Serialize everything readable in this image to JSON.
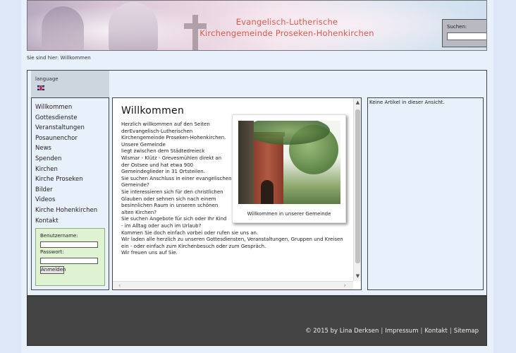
{
  "header": {
    "title_line1": "Evangelisch-Lutherische",
    "title_line2": "Kirchengemeinde Proseken-Hohenkirchen",
    "search_label": "Suchen:",
    "search_value": "",
    "search_button_icon": "search-icon"
  },
  "breadcrumb": "Sie sind hier: Willkommen",
  "sidebar": {
    "language_label": "language",
    "language_flag_icon": "uk-flag-icon",
    "nav": [
      "Willkommen",
      "Gottesdienste",
      "Veranstaltungen",
      "Posaunenchor",
      "News",
      "Spenden",
      "Kirchen",
      "Kirche Proseken",
      "Bilder",
      "Videos",
      "Kirche Hohenkirchen",
      "Kontakt"
    ],
    "login": {
      "username_label": "Benutzername:",
      "password_label": "Passwort:",
      "button_label": "Anmelden"
    }
  },
  "content": {
    "title": "Willkommen",
    "lines": [
      "Herzlich willkommen auf den Seiten",
      "derEvangelisch-Lutherischen",
      "Kirchengemeinde  Proseken-Hohenkirchen.",
      "Unsere Gemeinde",
      "liegt zwischen dem Städtedreieck",
      "Wismar - Klütz - Grevesmühlen direkt an",
      "der Ostsee und hat etwa 900",
      "Gemeindeglieder in 31 Ortsteilen.",
      "Sie suchen Anschluss in einer evangelischen",
      "Gemeinde?",
      "Sie interessieren sich für den christlichen",
      "Glauben oder sehnen sich nach einem",
      "besinnlichen Raum in unseren schönen",
      "alten Kirchen?",
      "Sie suchen Angebote für sich oder Ihr Kind",
      "- im Alltag oder auch im Urlaub?",
      "Kommen Sie doch einfach vorbei oder rufen sie uns an.",
      "Wir laden alle herzlich zu unseren Gottesdiensten, Veranstaltungen, Gruppen und Kreisen",
      "ein - oder einfach zum Kirchenbesuch oder zum Gespräch.",
      "Wir freuen uns auf Sie."
    ],
    "photo_caption": "Willkommen in unserer Gemeinde"
  },
  "rightcol": {
    "text": "Keine Artikel in dieser Ansicht."
  },
  "footer": {
    "copyright": "©  2015  by Lina Derksen",
    "links": [
      "Impressum",
      "Kontakt",
      "Sitemap"
    ]
  },
  "colors": {
    "title_color": "#e0584a",
    "footer_bg": "#444444",
    "login_bg": "#dff3d2",
    "page_bg": "#dde7f7"
  }
}
